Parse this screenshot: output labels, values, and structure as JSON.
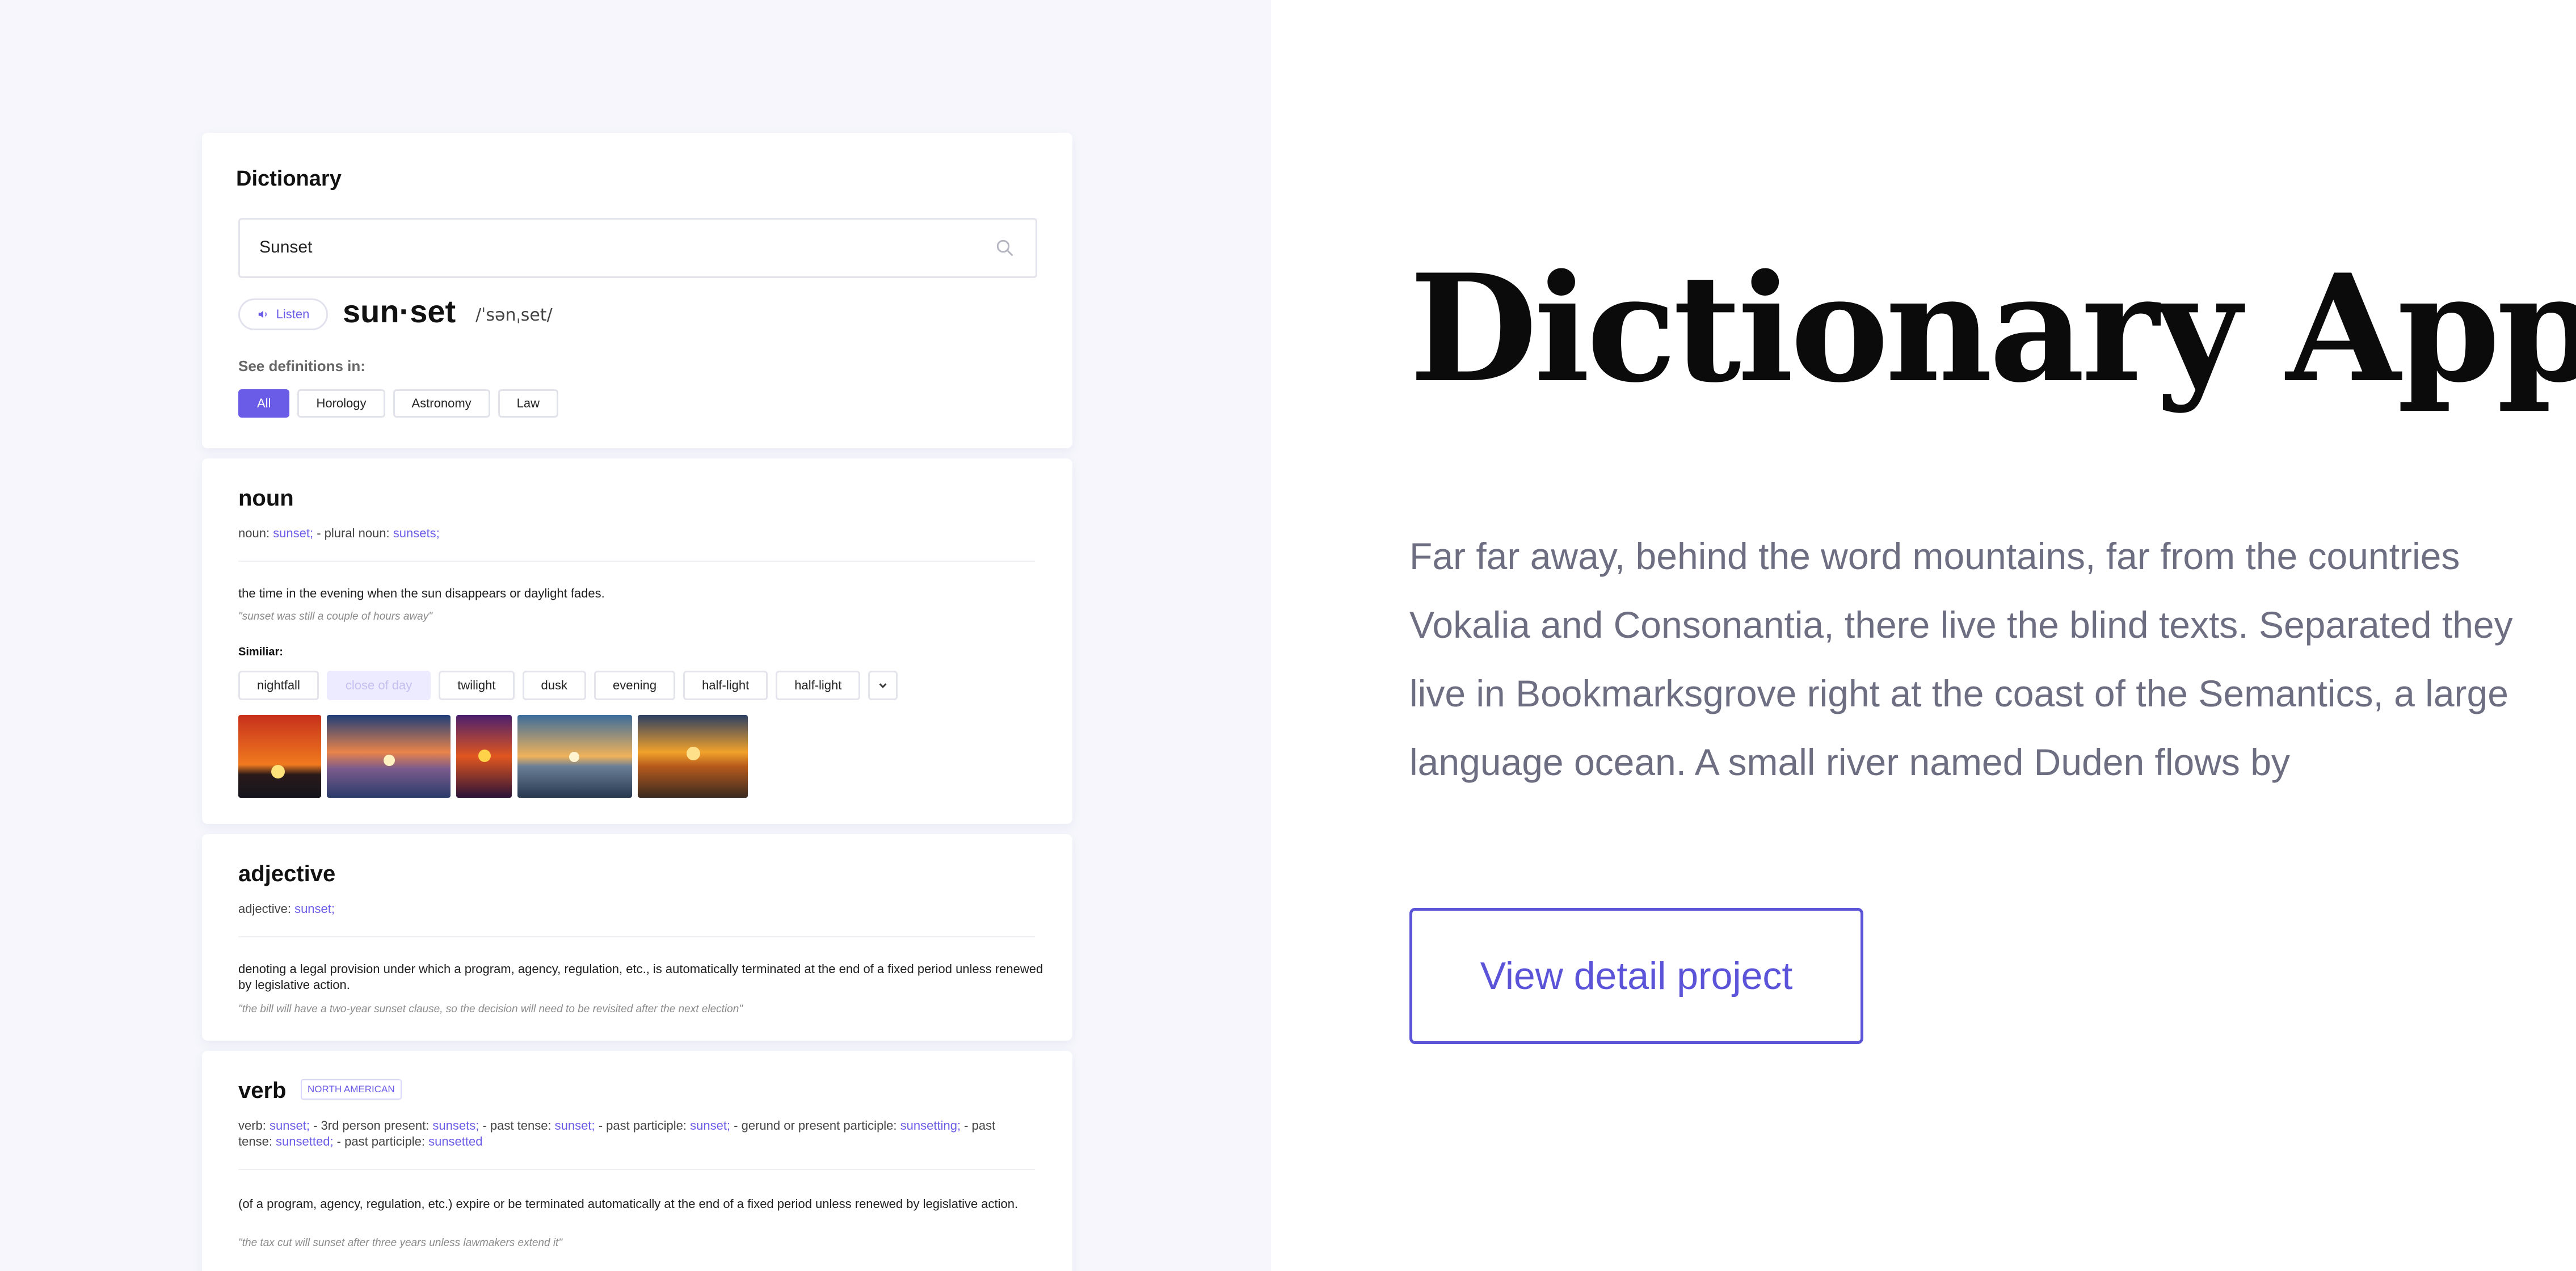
{
  "search_card": {
    "title": "Dictionary",
    "search_value": "Sunset",
    "listen_label": "Listen",
    "headword": "sun·set",
    "phonetic": "/ˈsənˌset/",
    "see_definitions_label": "See definitions in:",
    "filters": [
      "All",
      "Horology",
      "Astronomy",
      "Law"
    ],
    "active_filter": "All"
  },
  "noun": {
    "title": "noun",
    "forms": {
      "prefix": "noun: ",
      "word": "sunset;",
      "sep": "  -  plural noun: ",
      "plural": "sunsets;"
    },
    "definition": "the time in the evening when the sun disappears or daylight fades.",
    "example": "\"sunset was still a couple of hours away\"",
    "similar_label": "Similiar:",
    "synonyms": [
      "nightfall",
      "close of day",
      "twilight",
      "dusk",
      "evening",
      "half-light",
      "half-light"
    ],
    "image_alt": "sunset photos"
  },
  "adjective": {
    "title": "adjective",
    "forms": {
      "prefix": "adjective: ",
      "word": "sunset;"
    },
    "definition": "denoting a legal provision under which a program, agency, regulation, etc., is automatically terminated at the end of a fixed period unless renewed by legislative action.",
    "example": "\"the bill will have a two-year sunset clause, so the decision will need to be revisited after the next election\""
  },
  "verb": {
    "title": "verb",
    "tag": "NORTH AMERICAN",
    "forms": {
      "p1": "verb: ",
      "w1": "sunset;",
      "p2": "  -  3rd person present: ",
      "w2": "sunsets;",
      "p3": "  -  past tense: ",
      "w3": "sunset;",
      "p4": "  -  past participle: ",
      "w4": "sunset;",
      "p5": "  -  gerund or present participle: ",
      "w5": "sunsetting;",
      "p6": "  -  past tense: ",
      "w6": "sunsetted;",
      "p7": "  -  past participle: ",
      "w7": "sunsetted"
    },
    "definition": "(of a program, agency, regulation, etc.) expire or be terminated automatically at the end of a fixed period unless renewed by legislative action.",
    "example": "\"the tax cut will sunset after three years unless lawmakers extend it\""
  },
  "hero": {
    "title": "Dictionary App",
    "description": "Far far away, behind the word mountains, far from the countries Vokalia and Consonantia, there live the blind texts. Separated they live in Bookmarksgrove right at the coast of the Semantics, a large language ocean. A small river named Duden flows by",
    "cta_label": "View detail project"
  },
  "colors": {
    "accent": "#6b5ce7",
    "panel_bg": "#f6f6fc",
    "title": "#0b0b0b",
    "muted": "#6e6e82"
  }
}
